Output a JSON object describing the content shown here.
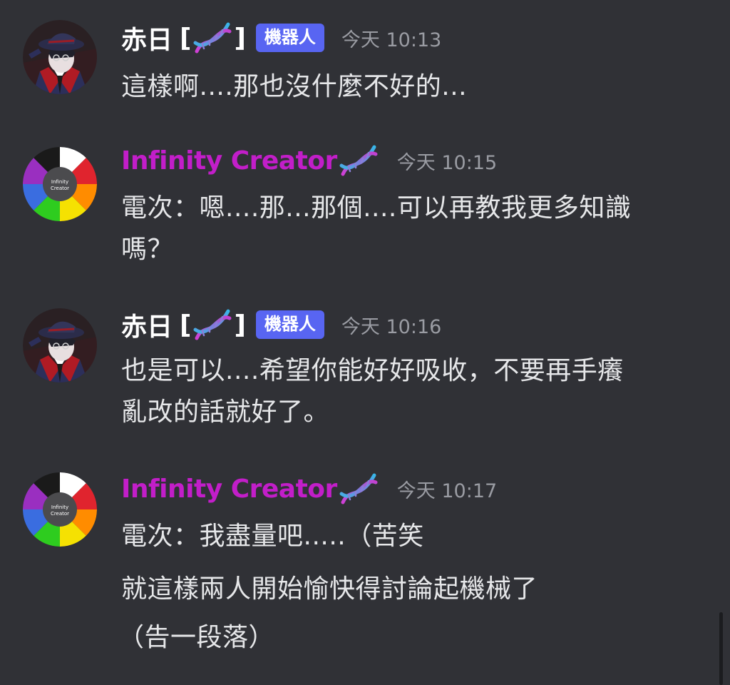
{
  "bot_badge": "機器人",
  "messages": [
    {
      "author": "赤日",
      "bracket_open": "[",
      "bracket_close": "]",
      "emoji": "dna-icon",
      "time": "今天 10:13",
      "lines": [
        "這樣啊....那也沒什麼不好的..."
      ]
    },
    {
      "author": "Infinity Creator",
      "emoji": "dna-icon",
      "avatar_text": [
        "Infinity",
        "Creator"
      ],
      "time": "今天 10:15",
      "lines": [
        "電次：嗯....那...那個....可以再教我更多知識",
        "嗎？"
      ]
    },
    {
      "author": "赤日",
      "bracket_open": "[",
      "bracket_close": "]",
      "emoji": "dna-icon",
      "time": "今天 10:16",
      "lines": [
        "也是可以....希望你能好好吸收，不要再手癢",
        "亂改的話就好了。"
      ]
    },
    {
      "author": "Infinity Creator",
      "emoji": "dna-icon",
      "avatar_text": [
        "Infinity",
        "Creator"
      ],
      "time": "今天 10:17",
      "lines": [
        "電次：我盡量吧.....（苦笑",
        "就這樣兩人開始愉快得討論起機械了",
        "（告一段落）"
      ]
    }
  ],
  "colors": {
    "background": "#303136",
    "creator_name": "#c21ec9",
    "bot_badge": "#5865f2",
    "timestamp": "#9a9ca3"
  }
}
